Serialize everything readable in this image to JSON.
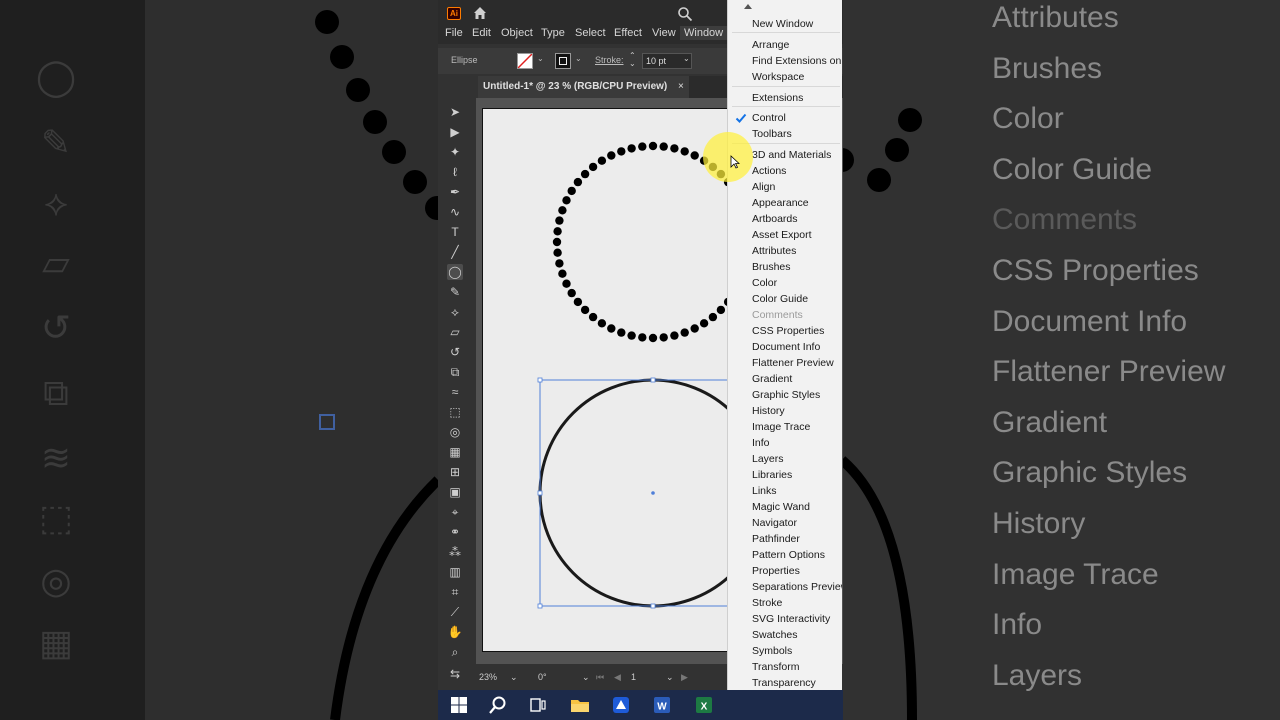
{
  "app": {
    "logo": "Ai",
    "menu": [
      "File",
      "Edit",
      "Object",
      "Type",
      "Select",
      "Effect",
      "View",
      "Window"
    ],
    "active_menu": "Window",
    "control": {
      "object_type": "Ellipse",
      "stroke_label": "Stroke:",
      "stroke_value": "10 pt"
    },
    "tab_title": "Untitled-1* @ 23 % (RGB/CPU Preview)",
    "tab_close": "×",
    "status": {
      "zoom": "23%",
      "rotation": "0°",
      "artboard": "1"
    }
  },
  "window_menu": {
    "items": [
      {
        "label": "New Window"
      },
      {
        "label": "Arrange"
      },
      {
        "label": "Find Extensions on Exchange..."
      },
      {
        "label": "Workspace"
      },
      {
        "label": "Extensions"
      },
      {
        "label": "Control",
        "checked": true
      },
      {
        "label": "Toolbars"
      },
      {
        "label": "3D and Materials"
      },
      {
        "label": "Actions"
      },
      {
        "label": "Align"
      },
      {
        "label": "Appearance"
      },
      {
        "label": "Artboards"
      },
      {
        "label": "Asset Export"
      },
      {
        "label": "Attributes"
      },
      {
        "label": "Brushes"
      },
      {
        "label": "Color"
      },
      {
        "label": "Color Guide"
      },
      {
        "label": "Comments",
        "disabled": true
      },
      {
        "label": "CSS Properties"
      },
      {
        "label": "Document Info"
      },
      {
        "label": "Flattener Preview"
      },
      {
        "label": "Gradient"
      },
      {
        "label": "Graphic Styles"
      },
      {
        "label": "History"
      },
      {
        "label": "Image Trace"
      },
      {
        "label": "Info"
      },
      {
        "label": "Layers"
      },
      {
        "label": "Libraries"
      },
      {
        "label": "Links"
      },
      {
        "label": "Magic Wand"
      },
      {
        "label": "Navigator"
      },
      {
        "label": "Pathfinder"
      },
      {
        "label": "Pattern Options"
      },
      {
        "label": "Properties"
      },
      {
        "label": "Separations Preview"
      },
      {
        "label": "Stroke"
      },
      {
        "label": "SVG Interactivity"
      },
      {
        "label": "Swatches"
      },
      {
        "label": "Symbols"
      },
      {
        "label": "Transform"
      },
      {
        "label": "Transparency"
      }
    ]
  },
  "background_zoom_menu": [
    {
      "label": "Attributes"
    },
    {
      "label": "Brushes"
    },
    {
      "label": "Color"
    },
    {
      "label": "Color Guide"
    },
    {
      "label": "Comments",
      "disabled": true
    },
    {
      "label": "CSS Properties"
    },
    {
      "label": "Document Info"
    },
    {
      "label": "Flattener Preview"
    },
    {
      "label": "Gradient"
    },
    {
      "label": "Graphic Styles"
    },
    {
      "label": "History"
    },
    {
      "label": "Image Trace"
    },
    {
      "label": "Info"
    },
    {
      "label": "Layers"
    }
  ],
  "taskbar": {
    "icons": [
      "windows-start-icon",
      "search-icon",
      "task-view-icon",
      "file-explorer-icon",
      "app-icon",
      "word-icon",
      "excel-icon"
    ]
  },
  "colors": {
    "menu_bg": "#f2f2f2",
    "check_blue": "#1473e6",
    "cursor_highlight": "#fff03c",
    "taskbar": "#1c2a4a",
    "selection": "#4f7fd8"
  }
}
